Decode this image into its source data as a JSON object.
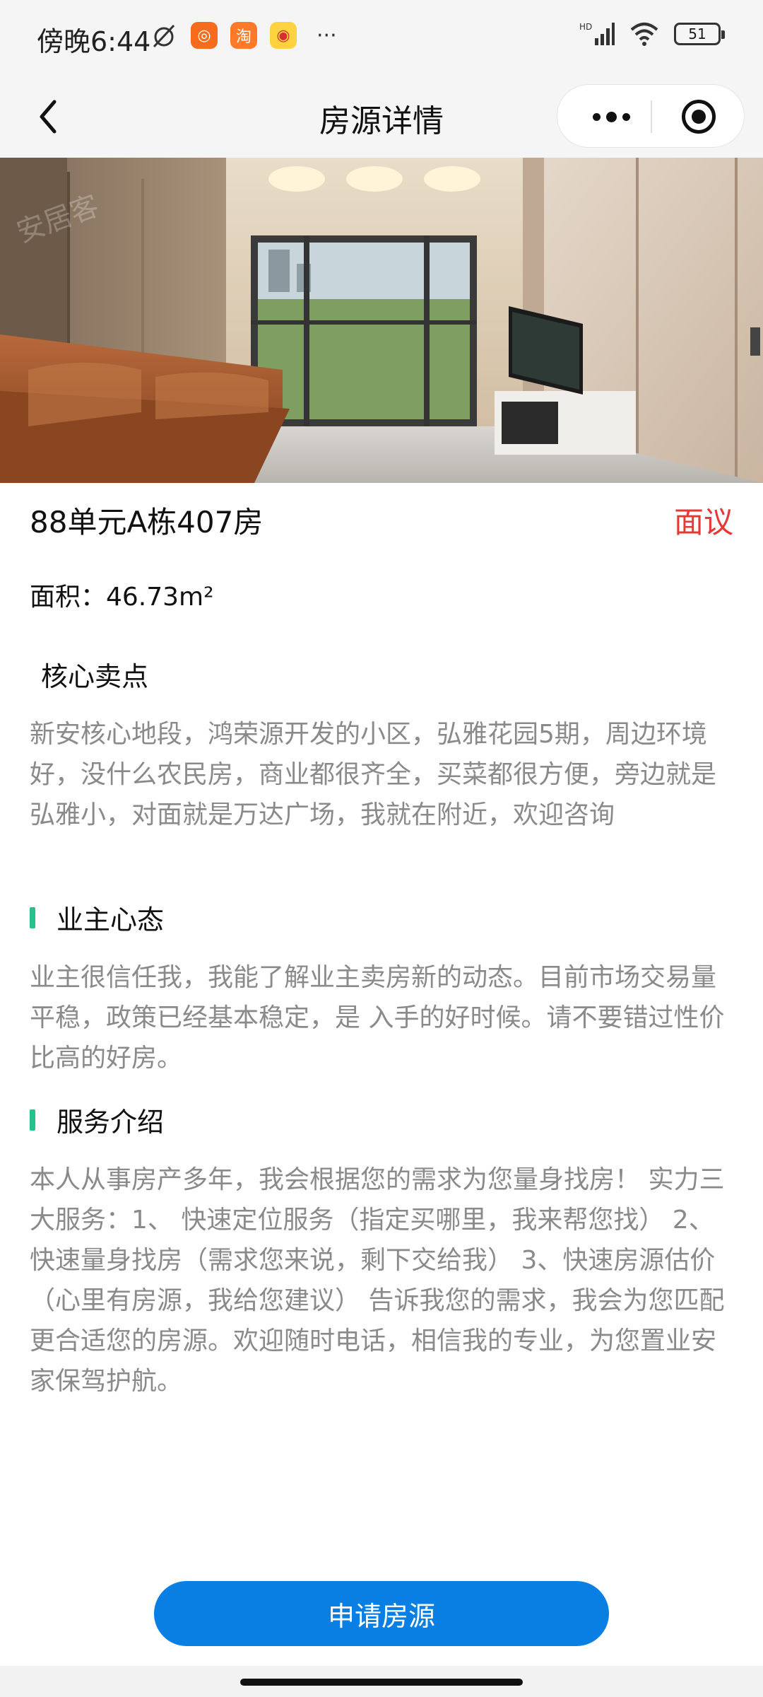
{
  "status_bar": {
    "time": "傍晚6:44",
    "more": "···",
    "battery": "51"
  },
  "nav": {
    "title": "房源详情"
  },
  "listing": {
    "title": "88单元A栋407房",
    "price": "面议",
    "area": "面积：46.73m²"
  },
  "sections": {
    "selling_points": {
      "title": "核心卖点",
      "text": "新安核心地段，鸿荣源开发的小区，弘雅花园5期，周边环境好，没什么农民房，商业都很齐全，买菜都很方便，旁边就是弘雅小，对面就是万达广场，我就在附近，欢迎咨询"
    },
    "owner_attitude": {
      "title": "业主心态",
      "text": "业主很信任我，我能了解业主卖房新的动态。目前市场交易量平稳，政策已经基本稳定，是 入手的好时候。请不要错过性价比高的好房。"
    },
    "service": {
      "title": "服务介绍",
      "text": "本人从事房产多年，我会根据您的需求为您量身找房！ 实力三大服务：1、 快速定位服务（指定买哪里，我来帮您找） 2、 快速量身找房（需求您来说，剩下交给我） 3、快速房源估价（心里有房源，我给您建议） 告诉我您的需求，我会为您匹配更合适您的房源。欢迎随时电话，相信我的专业，为您置业安家保驾护航。"
    }
  },
  "actions": {
    "apply_label": "申请房源"
  },
  "colors": {
    "accent_green": "#26c28b",
    "price_red": "#e53935",
    "button_blue": "#0a7fe3"
  }
}
